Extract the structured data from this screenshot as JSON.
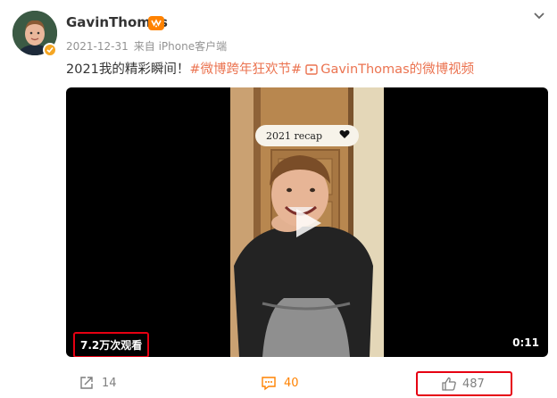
{
  "post": {
    "author": "GavinThomas",
    "date": "2021-12-31",
    "source": "来自 iPhone客户端",
    "text_plain": "2021我的精彩瞬间！",
    "hashtag": "#微博跨年狂欢节#",
    "video_link": "GavinThomas的微博视频"
  },
  "video": {
    "overlay_caption": "2021 recap",
    "views": "7.2万次观看",
    "duration": "0:11"
  },
  "actions": {
    "share_count": "14",
    "comment_count": "40",
    "like_count": "487"
  },
  "colors": {
    "link": "#eb7350",
    "accent": "#ff8200",
    "highlight_box": "#e60012"
  },
  "icons": [
    "verified-icon",
    "vip-badge-icon",
    "chevron-down-icon",
    "video-link-icon",
    "heart-icon",
    "play-icon",
    "share-icon",
    "comment-icon",
    "thumbs-up-icon"
  ]
}
